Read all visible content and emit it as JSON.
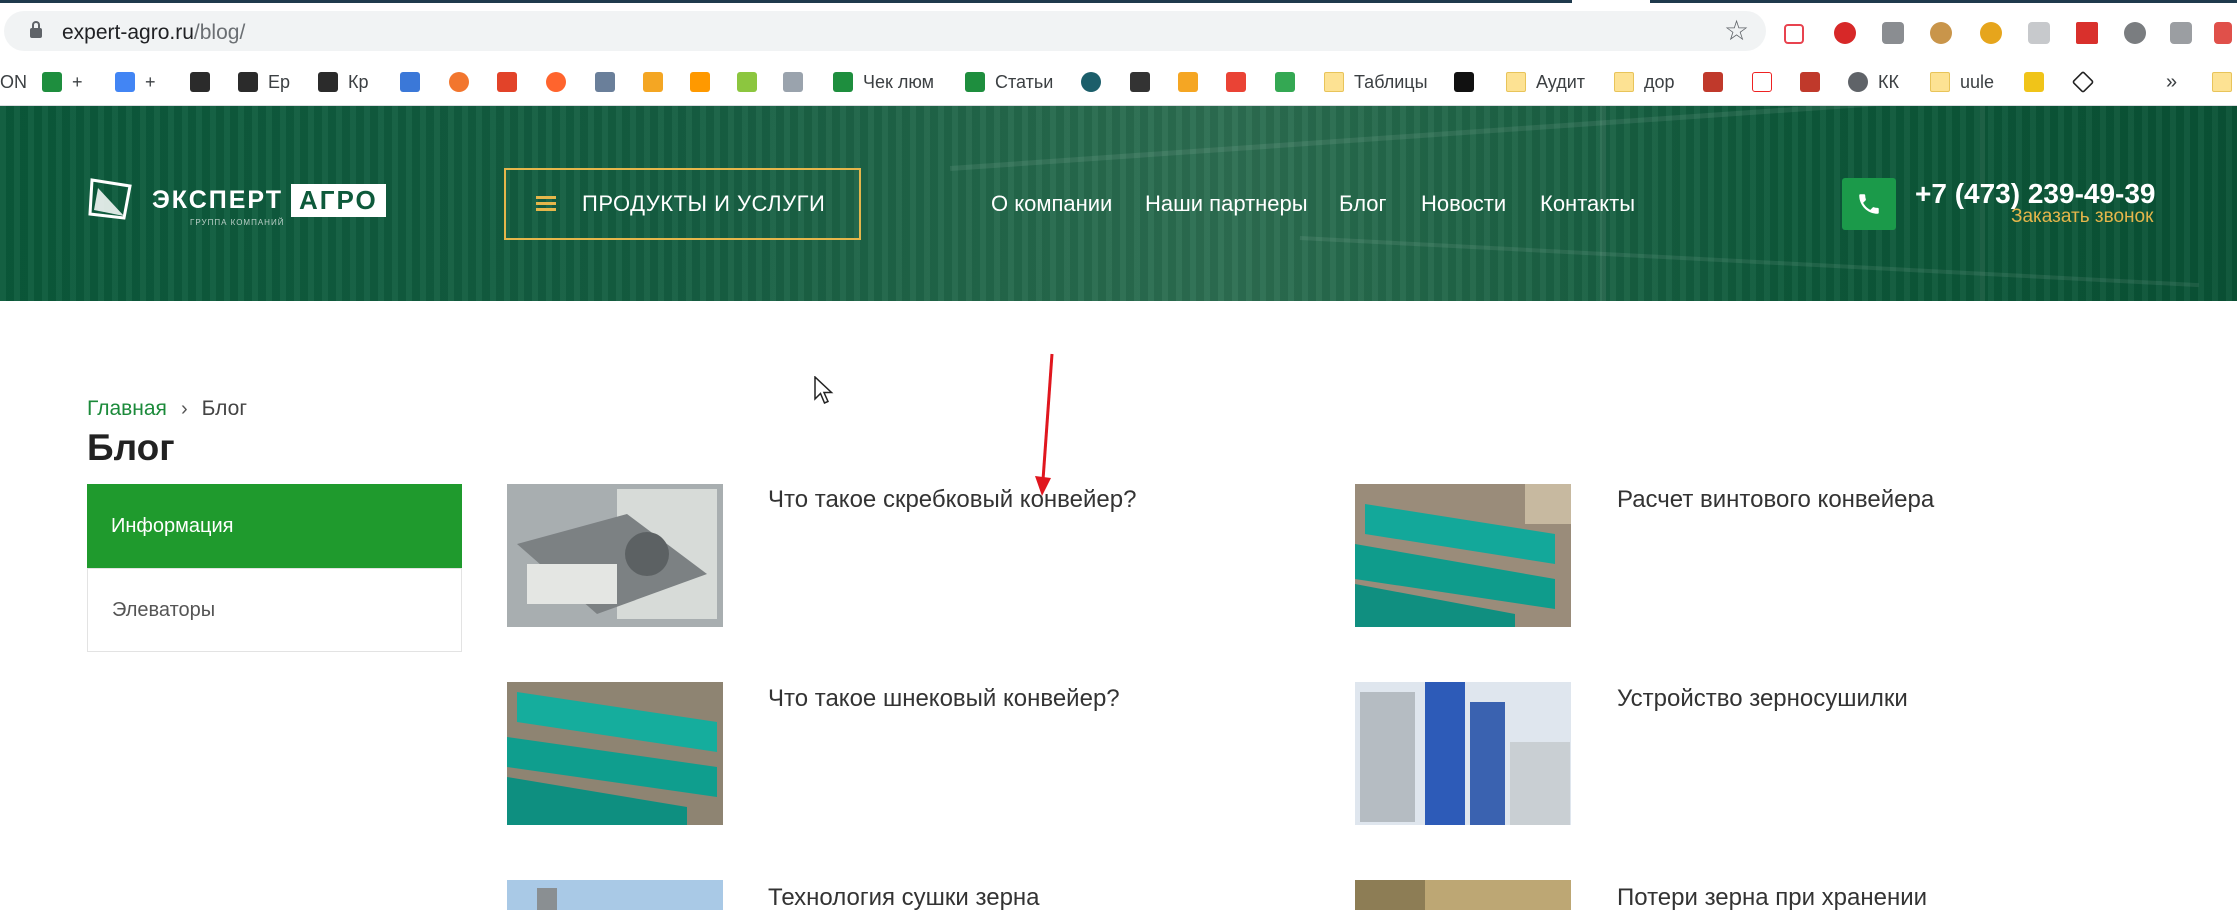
{
  "browser": {
    "url_host": "expert-agro.ru",
    "url_path": "/blog/"
  },
  "bookmarks": [
    {
      "label": "ON",
      "icon": "partial-icon"
    },
    {
      "label": "+",
      "icon": "sheets-icon"
    },
    {
      "label": "+",
      "icon": "docs-icon"
    },
    {
      "label": "",
      "icon": "fa-icon"
    },
    {
      "label": "Ep",
      "icon": "fa-icon"
    },
    {
      "label": "Кр",
      "icon": "fa-icon"
    },
    {
      "label": "",
      "icon": "analytics-icon"
    },
    {
      "label": "",
      "icon": "grafana-icon"
    },
    {
      "label": "",
      "icon": "gitlab-icon"
    },
    {
      "label": "",
      "icon": "semrush-icon"
    },
    {
      "label": "",
      "icon": "hat-icon"
    },
    {
      "label": "",
      "icon": "bars-icon"
    },
    {
      "label": "",
      "icon": "amazon-icon"
    },
    {
      "label": "",
      "icon": "check-icon"
    },
    {
      "label": "",
      "icon": "gt-icon"
    },
    {
      "label": "Чек люм",
      "icon": "sheets-icon"
    },
    {
      "label": "Статьи",
      "icon": "sheets-icon"
    },
    {
      "label": "",
      "icon": "circle-icon"
    },
    {
      "label": "",
      "icon": "route-icon"
    },
    {
      "label": "",
      "icon": "mail-icon"
    },
    {
      "label": "",
      "icon": "gmail-icon"
    },
    {
      "label": "",
      "icon": "drive-icon"
    },
    {
      "label": "Таблицы",
      "icon": "folder-icon"
    },
    {
      "label": "",
      "icon": "notion-icon"
    },
    {
      "label": "Аудит",
      "icon": "folder-icon"
    },
    {
      "label": "дор",
      "icon": "folder-icon"
    },
    {
      "label": "",
      "icon": "code-icon"
    },
    {
      "label": "",
      "icon": "yandex-icon"
    },
    {
      "label": "",
      "icon": "xml-icon"
    },
    {
      "label": "КК",
      "icon": "globe-icon"
    },
    {
      "label": "uule",
      "icon": "folder-icon"
    },
    {
      "label": "",
      "icon": "pen-icon"
    },
    {
      "label": "",
      "icon": "codepen-icon"
    },
    {
      "label": "»",
      "icon": "more-icon"
    }
  ],
  "header": {
    "logo_text": "ЭКСПЕРТ",
    "logo_box": "АГРО",
    "logo_sub": "ГРУППА КОМПАНИЙ",
    "menu_button": "ПРОДУКТЫ И УСЛУГИ",
    "nav": [
      "О компании",
      "Наши партнеры",
      "Блог",
      "Новости",
      "Контакты"
    ],
    "phone": "+7 (473) 239-49-39",
    "callback": "Заказать звонок"
  },
  "breadcrumb": {
    "home": "Главная",
    "separator": "›",
    "current": "Блог"
  },
  "page_title": "Блог",
  "sidebar": {
    "items": [
      "Информация",
      "Элеваторы"
    ],
    "active": "Информация"
  },
  "posts": [
    {
      "title": "Что такое скребковый конвейер?",
      "image": "scraper-conveyor"
    },
    {
      "title": "Расчет винтового конвейера",
      "image": "screw-conveyor"
    },
    {
      "title": "Что такое шнековый конвейер?",
      "image": "auger-conveyor"
    },
    {
      "title": "Устройство зерносушилки",
      "image": "grain-dryer"
    },
    {
      "title": "Технология сушки зерна",
      "image": "drying-technology"
    },
    {
      "title": "Потери зерна при хранении",
      "image": "grain-storage"
    }
  ],
  "colors": {
    "header_green": "#0e5a3b",
    "accent_gold": "#e5b64b",
    "active_green": "#1f9a2d",
    "link_green": "#1b8a3a",
    "annotation_red": "#e0161e"
  }
}
